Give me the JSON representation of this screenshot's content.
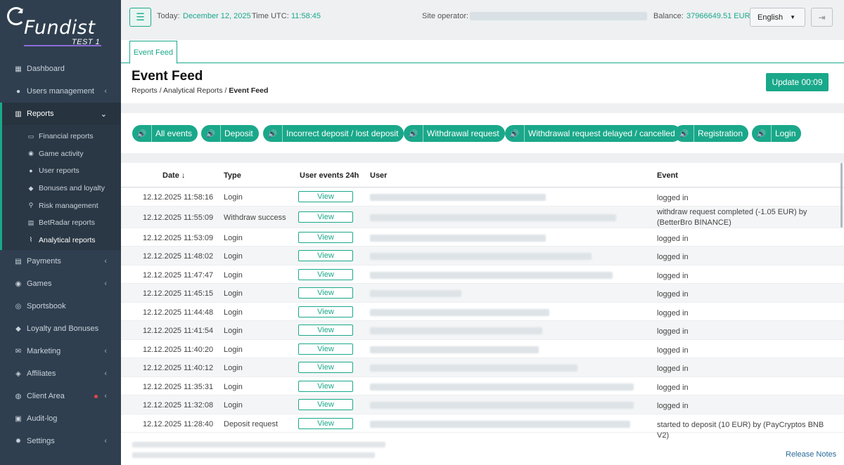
{
  "brand": {
    "name": "Fundist",
    "sub": "TEST 1"
  },
  "sidebar": {
    "items": [
      {
        "label": "Dashboard",
        "icon": "dashboard-icon",
        "glyph": "▦"
      },
      {
        "label": "Users management",
        "icon": "user-icon",
        "glyph": "●"
      },
      {
        "label": "Reports",
        "icon": "chart-icon",
        "glyph": "▥"
      },
      {
        "label": "Payments",
        "icon": "wallet-icon",
        "glyph": "▤"
      },
      {
        "label": "Games",
        "icon": "gamepad-icon",
        "glyph": "◉"
      },
      {
        "label": "Sportsbook",
        "icon": "ball-icon",
        "glyph": "◎"
      },
      {
        "label": "Loyalty and Bonuses",
        "icon": "diamond-icon",
        "glyph": "◆"
      },
      {
        "label": "Marketing",
        "icon": "envelope-icon",
        "glyph": "✉"
      },
      {
        "label": "Affiliates",
        "icon": "handshake-icon",
        "glyph": "◈"
      },
      {
        "label": "Client Area",
        "icon": "compass-icon",
        "glyph": "◍"
      },
      {
        "label": "Audit-log",
        "icon": "database-icon",
        "glyph": "▣"
      },
      {
        "label": "Settings",
        "icon": "gear-icon",
        "glyph": "✹"
      }
    ],
    "reports_sub": [
      {
        "label": "Financial reports",
        "icon": "money-icon",
        "glyph": "▭"
      },
      {
        "label": "Game activity",
        "icon": "gamepad-icon",
        "glyph": "◉"
      },
      {
        "label": "User reports",
        "icon": "user-icon",
        "glyph": "●"
      },
      {
        "label": "Bonuses and loyalty",
        "icon": "diamond-icon",
        "glyph": "◆"
      },
      {
        "label": "Risk management",
        "icon": "search-icon",
        "glyph": "⚲"
      },
      {
        "label": "BetRadar reports",
        "icon": "table-icon",
        "glyph": "▤"
      },
      {
        "label": "Analytical reports",
        "icon": "line-chart-icon",
        "glyph": "⌇"
      }
    ]
  },
  "topbar": {
    "today_label": "Today:",
    "today_value": "December 12, 2025",
    "time_label": "Time UTC:",
    "time_value": "11:58:45",
    "operator_label": "Site operator:",
    "balance_label": "Balance:",
    "balance_value": "37966649.51 EUR",
    "language": "English"
  },
  "tab": {
    "label": "Event Feed"
  },
  "page": {
    "title": "Event Feed",
    "breadcrumb": [
      "Reports",
      "Analytical Reports",
      "Event Feed"
    ],
    "separator": "/",
    "update_button": "Update 00:09"
  },
  "filters": [
    "All events",
    "Deposit",
    "Incorrect deposit / lost deposit",
    "Withdrawal request",
    "Withdrawal request delayed / cancelled",
    "Registration",
    "Login"
  ],
  "table": {
    "headers": {
      "date": "Date ↓",
      "type": "Type",
      "events24": "User events 24h",
      "user": "User",
      "event": "Event"
    },
    "view_label": "View",
    "rows": [
      {
        "date": "12.12.2025 11:58:16",
        "type": "Login",
        "event": "logged in"
      },
      {
        "date": "12.12.2025 11:55:09",
        "type": "Withdraw success",
        "event": "withdraw request completed (-1.05 EUR) by (BetterBro BINANCE)"
      },
      {
        "date": "12.12.2025 11:53:09",
        "type": "Login",
        "event": "logged in"
      },
      {
        "date": "12.12.2025 11:48:02",
        "type": "Login",
        "event": "logged in"
      },
      {
        "date": "12.12.2025 11:47:47",
        "type": "Login",
        "event": "logged in"
      },
      {
        "date": "12.12.2025 11:45:15",
        "type": "Login",
        "event": "logged in"
      },
      {
        "date": "12.12.2025 11:44:48",
        "type": "Login",
        "event": "logged in"
      },
      {
        "date": "12.12.2025 11:41:54",
        "type": "Login",
        "event": "logged in"
      },
      {
        "date": "12.12.2025 11:40:20",
        "type": "Login",
        "event": "logged in"
      },
      {
        "date": "12.12.2025 11:40:12",
        "type": "Login",
        "event": "logged in"
      },
      {
        "date": "12.12.2025 11:35:31",
        "type": "Login",
        "event": "logged in"
      },
      {
        "date": "12.12.2025 11:32:08",
        "type": "Login",
        "event": "logged in"
      },
      {
        "date": "12.12.2025 11:28:40",
        "type": "Deposit request",
        "event": "started to deposit (10 EUR) by (PayCryptos BNB V2)"
      }
    ]
  },
  "footer": {
    "release_notes": "Release Notes"
  },
  "colors": {
    "accent": "#1aa88a",
    "sidebar": "#2f3f4f"
  }
}
